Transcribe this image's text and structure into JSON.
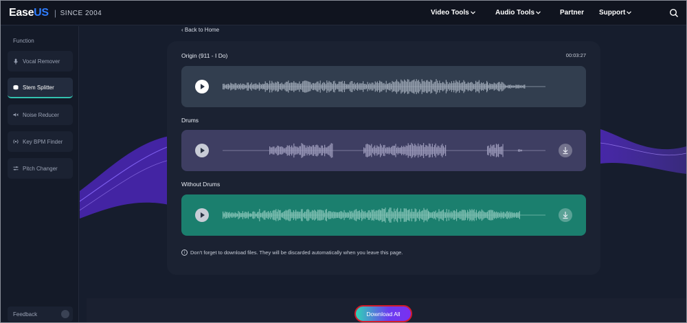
{
  "brand": {
    "name_prefix": "Ease",
    "name_suffix": "US",
    "separator": "|",
    "since": "SINCE 2004"
  },
  "nav": {
    "items": [
      {
        "label": "Video Tools",
        "has_dropdown": true
      },
      {
        "label": "Audio Tools",
        "has_dropdown": true
      },
      {
        "label": "Partner",
        "has_dropdown": false
      },
      {
        "label": "Support",
        "has_dropdown": true
      }
    ],
    "search_icon": "search-icon"
  },
  "sidebar": {
    "title": "Function",
    "items": [
      {
        "label": "Vocal Remover",
        "icon": "microphone-icon",
        "active": false
      },
      {
        "label": "Stem Splitter",
        "icon": "drum-icon",
        "active": true
      },
      {
        "label": "Noise Reducer",
        "icon": "noise-icon",
        "active": false
      },
      {
        "label": "Key BPM Finder",
        "icon": "bpm-icon",
        "active": false
      },
      {
        "label": "Pitch Changer",
        "icon": "pitch-icon",
        "active": false
      }
    ],
    "feedback_label": "Feedback"
  },
  "main": {
    "back_label": "Back to Home",
    "tracks": [
      {
        "title": "Origin (911 - I Do)",
        "duration": "00:03:27",
        "downloadable": false
      },
      {
        "title": "Drums",
        "downloadable": true
      },
      {
        "title": "Without Drums",
        "downloadable": true
      }
    ],
    "notice": "Don't forget to download files. They will be discarded automatically when you leave this page.",
    "download_all_label": "Download All"
  },
  "colors": {
    "accent_teal": "#1b7f6e",
    "drums_track": "#3e3e62",
    "origin_track": "#323e4f",
    "brand_blue": "#2f7dff",
    "highlight_red": "#d11b2b"
  }
}
